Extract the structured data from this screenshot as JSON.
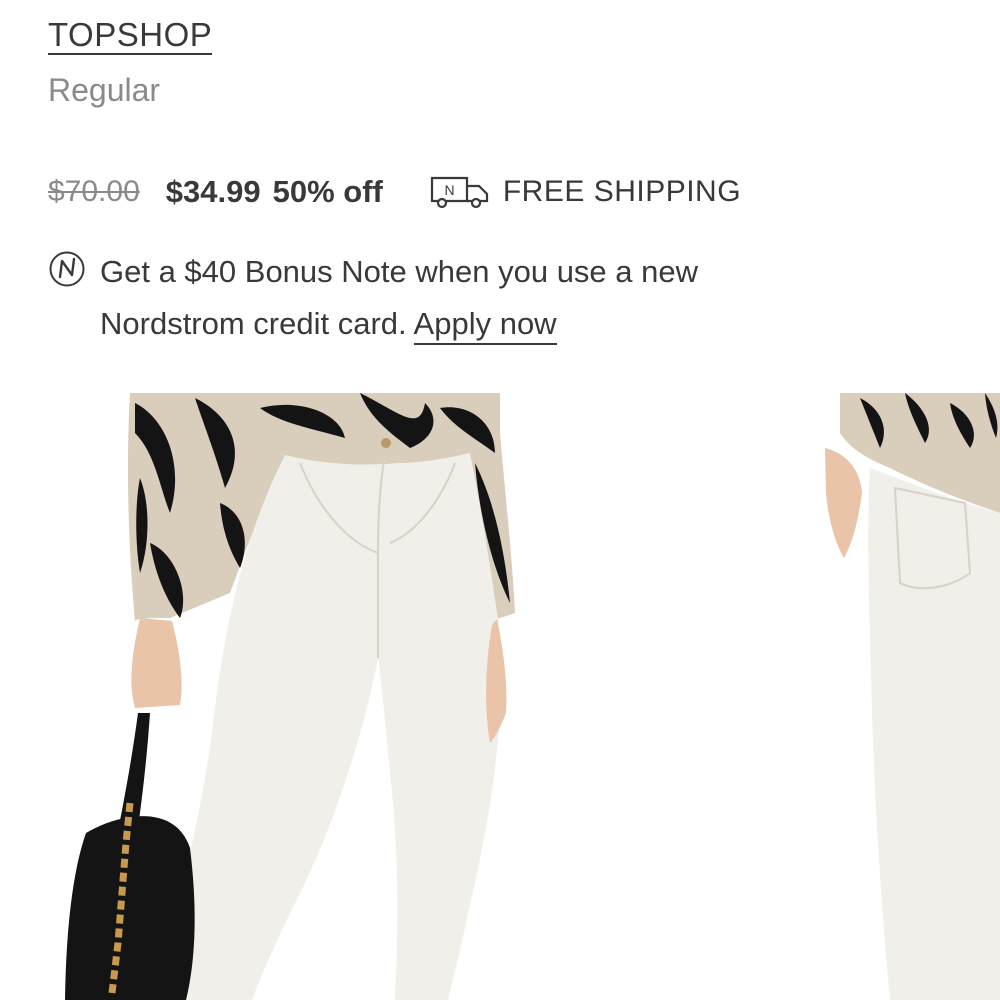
{
  "product": {
    "brand": "TOPSHOP",
    "fit": "Regular"
  },
  "pricing": {
    "original_price": "$70.00",
    "sale_price": "$34.99",
    "discount": "50% off",
    "shipping_label": "FREE SHIPPING",
    "shipping_icon": "delivery-truck-icon",
    "shipping_icon_letter": "N"
  },
  "promo": {
    "icon": "nordstrom-note-icon",
    "text": "Get a $40 Bonus Note when you use a new Nordstrom credit card.",
    "link_label": "Apply now"
  },
  "gallery": {
    "images": [
      {
        "name": "front-view",
        "alt": "model wearing white skinny jeans, front view"
      },
      {
        "name": "back-view",
        "alt": "model wearing white skinny jeans, back view"
      }
    ]
  },
  "colors": {
    "text": "#393939",
    "muted": "#8a8a8a",
    "sweater": "#d9cdbb",
    "jeans": "#f1efe9"
  }
}
